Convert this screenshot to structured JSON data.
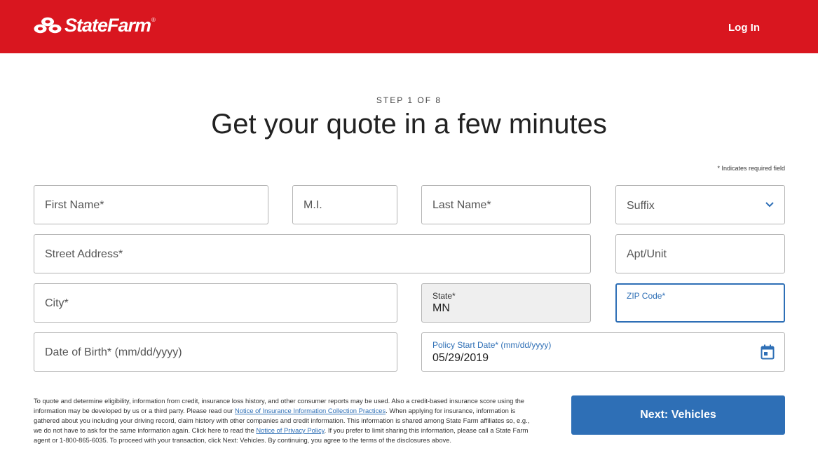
{
  "header": {
    "brand": "StateFarm",
    "brand_reg": "®",
    "login_label": "Log In",
    "bg_color": "#d9161f"
  },
  "hero": {
    "step": "STEP 1 OF 8",
    "title": "Get your quote in a few minutes"
  },
  "form": {
    "required_note": "* Indicates required field",
    "first_name": {
      "placeholder": "First Name*"
    },
    "middle_initial": {
      "placeholder": "M.I."
    },
    "last_name": {
      "placeholder": "Last Name*"
    },
    "suffix": {
      "placeholder": "Suffix"
    },
    "street_address": {
      "placeholder": "Street Address*"
    },
    "apt_unit": {
      "placeholder": "Apt/Unit"
    },
    "city": {
      "placeholder": "City*"
    },
    "state": {
      "label": "State*",
      "value": "MN"
    },
    "zip": {
      "label": "ZIP Code*",
      "value": ""
    },
    "dob": {
      "placeholder": "Date of Birth* (mm/dd/yyyy)"
    },
    "policy_start": {
      "label": "Policy Start Date* (mm/dd/yyyy)",
      "value": "05/29/2019"
    }
  },
  "disclaimer": {
    "part1": "To quote and determine eligibility, information from credit, insurance loss history, and other consumer reports may be used. Also a credit-based insurance score using the information may be developed by us or a third party. Please read our ",
    "link1": "Notice of Insurance Information Collection Practices",
    "part2": ". When applying for insurance, information is gathered about you including your driving record, claim history with other companies and credit information. This information is shared among State Farm affiliates so, e.g., we do not have to ask for the same information again. Click here to read the ",
    "link2": "Notice of Privacy Policy",
    "part3": ". If you prefer to limit sharing this information, please call a State Farm agent or 1-800-865-6035. To proceed with your transaction, click Next: Vehicles. By continuing, you agree to the terms of the disclosures above."
  },
  "next_button": {
    "label": "Next: Vehicles",
    "color": "#2e6fb6"
  }
}
